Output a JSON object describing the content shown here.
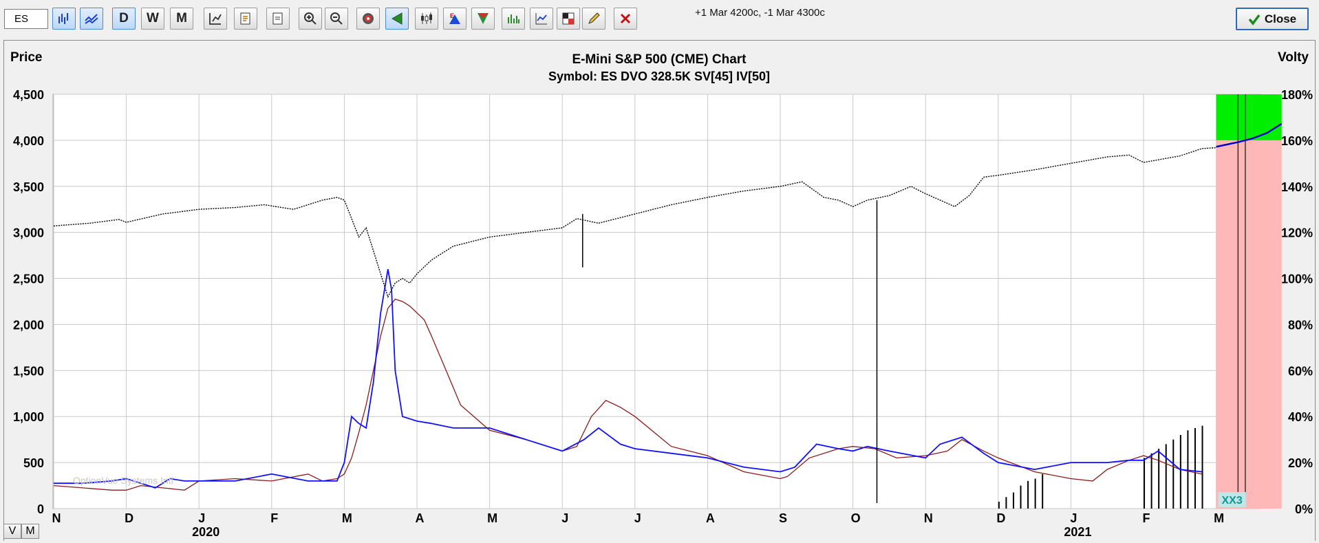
{
  "toolbar": {
    "symbol": "ES",
    "period_buttons": [
      "D",
      "W",
      "M"
    ],
    "info": "+1 Mar 4200c, -1 Mar 4300c",
    "close_label": "Close"
  },
  "view_buttons": [
    "V",
    "M"
  ],
  "chart_data": {
    "type": "bar",
    "title": "E-Mini S&P 500 (CME) Chart",
    "subtitle": "Symbol: ES  DVO 328.5K  SV[45]  IV[50]",
    "ylabel_left": "Price",
    "ylabel_right": "Volty",
    "watermark": "OptionVue Systems Intl",
    "badge": "XX3",
    "ylim_left": [
      0,
      4500
    ],
    "ylim_right": [
      0,
      180
    ],
    "left_ticks": [
      "4,500",
      "4,000",
      "3,500",
      "3,000",
      "2,500",
      "2,000",
      "1,500",
      "1,000",
      "500",
      "0"
    ],
    "right_ticks": [
      "180%",
      "160%",
      "140%",
      "120%",
      "100%",
      "80%",
      "60%",
      "40%",
      "20%",
      "0%"
    ],
    "x_month_labels": [
      "N",
      "D",
      "J",
      "F",
      "M",
      "A",
      "M",
      "J",
      "J",
      "A",
      "S",
      "O",
      "N",
      "D",
      "J",
      "F",
      "M"
    ],
    "x_year_labels": [
      {
        "label": "2020",
        "month_index": 2
      },
      {
        "label": "2021",
        "month_index": 14
      }
    ],
    "x_range": [
      0,
      16.6
    ],
    "grid": true,
    "colors": {
      "price": "#000000",
      "sv": "#1010ff",
      "iv": "#8b1a1a",
      "volume": "#000000",
      "profit": "#00ee00",
      "loss": "#ffb8b8",
      "expected": "#0000cc"
    },
    "price_series": {
      "name": "Price",
      "x": [
        0,
        0.5,
        0.9,
        1.0,
        1.5,
        2.0,
        2.5,
        2.9,
        3.3,
        3.7,
        3.9,
        4.0,
        4.1,
        4.2,
        4.3,
        4.4,
        4.5,
        4.6,
        4.7,
        4.8,
        4.9,
        5.0,
        5.2,
        5.5,
        6.0,
        6.5,
        7.0,
        7.2,
        7.5,
        8.0,
        8.5,
        9.0,
        9.5,
        10.0,
        10.3,
        10.6,
        10.8,
        11.0,
        11.2,
        11.5,
        11.8,
        12.0,
        12.2,
        12.4,
        12.6,
        12.8,
        13.0,
        13.5,
        14.0,
        14.5,
        14.8,
        15.0,
        15.5,
        15.8,
        16.0
      ],
      "y": [
        3070,
        3100,
        3140,
        3110,
        3200,
        3250,
        3270,
        3300,
        3250,
        3350,
        3380,
        3350,
        3150,
        2950,
        3050,
        2800,
        2550,
        2300,
        2450,
        2500,
        2450,
        2550,
        2700,
        2850,
        2950,
        3000,
        3050,
        3150,
        3100,
        3200,
        3300,
        3380,
        3450,
        3500,
        3550,
        3380,
        3350,
        3280,
        3350,
        3400,
        3500,
        3420,
        3350,
        3280,
        3400,
        3600,
        3620,
        3680,
        3750,
        3820,
        3840,
        3760,
        3830,
        3910,
        3920
      ]
    },
    "price_spikes": [
      {
        "x": 7.28,
        "y0": 2620,
        "y1": 3200
      },
      {
        "x": 11.33,
        "y0": 60,
        "y1": 3350
      }
    ],
    "sv_series": {
      "name": "SV[45]",
      "x": [
        0,
        0.4,
        0.8,
        1.0,
        1.2,
        1.4,
        1.6,
        1.8,
        2.0,
        2.5,
        3.0,
        3.5,
        3.7,
        3.9,
        4.0,
        4.1,
        4.2,
        4.3,
        4.4,
        4.5,
        4.6,
        4.65,
        4.7,
        4.8,
        5.0,
        5.2,
        5.5,
        6.0,
        6.5,
        7.0,
        7.3,
        7.5,
        7.8,
        8.0,
        8.5,
        9.0,
        9.5,
        10.0,
        10.2,
        10.5,
        10.8,
        11.0,
        11.2,
        11.5,
        12.0,
        12.2,
        12.5,
        12.8,
        13.0,
        13.5,
        14.0,
        14.5,
        14.8,
        15.0,
        15.2,
        15.5,
        15.8
      ],
      "y": [
        11,
        11,
        12,
        13,
        11,
        9,
        13,
        12,
        12,
        12,
        15,
        12,
        12,
        12,
        20,
        40,
        37,
        35,
        55,
        85,
        104,
        95,
        60,
        40,
        38,
        37,
        35,
        35,
        30,
        25,
        30,
        35,
        28,
        26,
        24,
        22,
        18,
        16,
        18,
        28,
        26,
        25,
        27,
        25,
        22,
        28,
        31,
        24,
        20,
        17,
        20,
        20,
        21,
        21,
        25,
        17,
        16
      ]
    },
    "iv_series": {
      "name": "IV[50]",
      "x": [
        0,
        0.4,
        0.8,
        1.0,
        1.2,
        1.5,
        1.8,
        2.0,
        2.5,
        3.0,
        3.5,
        3.7,
        3.9,
        4.0,
        4.1,
        4.2,
        4.3,
        4.4,
        4.5,
        4.6,
        4.7,
        4.8,
        4.9,
        5.0,
        5.1,
        5.2,
        5.4,
        5.6,
        6.0,
        6.5,
        7.0,
        7.2,
        7.4,
        7.6,
        7.8,
        8.0,
        8.5,
        9.0,
        9.5,
        10.0,
        10.1,
        10.4,
        10.8,
        11.0,
        11.3,
        11.6,
        12.0,
        12.3,
        12.5,
        12.8,
        13.0,
        13.5,
        14.0,
        14.3,
        14.5,
        14.8,
        15.0,
        15.2,
        15.5,
        15.8
      ],
      "y": [
        10,
        9,
        8,
        8,
        10,
        9,
        8,
        12,
        13,
        12,
        15,
        12,
        13,
        15,
        22,
        33,
        45,
        60,
        75,
        87,
        91,
        90,
        88,
        85,
        82,
        75,
        60,
        45,
        34,
        30,
        25,
        27,
        40,
        47,
        44,
        40,
        27,
        23,
        16,
        13,
        14,
        22,
        26,
        27,
        26,
        22,
        23,
        25,
        30,
        25,
        22,
        16,
        13,
        12,
        17,
        21,
        23,
        21,
        17,
        15
      ]
    },
    "volume_series": {
      "name": "Volume",
      "x": [
        13.0,
        13.1,
        13.2,
        13.3,
        13.4,
        13.5,
        13.6,
        15.0,
        15.1,
        15.2,
        15.3,
        15.4,
        15.5,
        15.6,
        15.7,
        15.8
      ],
      "y": [
        3,
        5,
        7,
        10,
        12,
        13,
        15,
        22,
        24,
        26,
        28,
        30,
        32,
        34,
        35,
        36
      ]
    },
    "risk_graph": {
      "x_start": 16.0,
      "x_end": 16.9,
      "breakeven_price": 4000,
      "expected": {
        "x": [
          16.0,
          16.3,
          16.5,
          16.7,
          16.9
        ],
        "y": [
          3930,
          3980,
          4020,
          4080,
          4180
        ]
      },
      "strikes": [
        16.3,
        16.4
      ]
    }
  }
}
